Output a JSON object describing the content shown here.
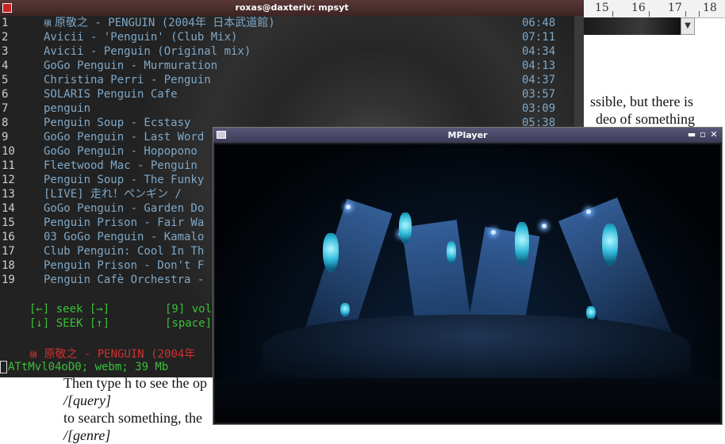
{
  "terminal": {
    "title": "roxas@daxteriv: mpsyt",
    "songs": [
      {
        "num": "1",
        "title": "原敬之 - PENGUIN (2004年 日本武道館)",
        "prefix": "槇",
        "duration": "06:48"
      },
      {
        "num": "2",
        "title": "Avicii - 'Penguin' (Club Mix)",
        "prefix": "",
        "duration": "07:11"
      },
      {
        "num": "3",
        "title": "Avicii - Penguin (Original mix)",
        "prefix": "",
        "duration": "04:34"
      },
      {
        "num": "4",
        "title": "GoGo Penguin - Murmuration",
        "prefix": "",
        "duration": "04:13"
      },
      {
        "num": "5",
        "title": "Christina Perri - Penguin",
        "prefix": "",
        "duration": "04:37"
      },
      {
        "num": "6",
        "title": "SOLARIS Penguin Cafe",
        "prefix": "",
        "duration": "03:57"
      },
      {
        "num": "7",
        "title": "penguin",
        "prefix": "",
        "duration": "03:09"
      },
      {
        "num": "8",
        "title": "Penguin Soup - Ecstasy",
        "prefix": "",
        "duration": "05:38"
      },
      {
        "num": "9",
        "title": "GoGo Penguin - Last Word",
        "prefix": "",
        "duration": ""
      },
      {
        "num": "10",
        "title": "GoGo Penguin - Hopopono",
        "prefix": "",
        "duration": ""
      },
      {
        "num": "11",
        "title": "Fleetwood Mac - Penguin",
        "prefix": "",
        "duration": ""
      },
      {
        "num": "12",
        "title": "Penguin Soup - The Funky",
        "prefix": "",
        "duration": ""
      },
      {
        "num": "13",
        "title": "[LIVE] 走れ！ペンギン /",
        "prefix": "",
        "duration": ""
      },
      {
        "num": "14",
        "title": "GoGo Penguin - Garden Do",
        "prefix": "",
        "duration": ""
      },
      {
        "num": "15",
        "title": "Penguin Prison - Fair Wa",
        "prefix": "",
        "duration": ""
      },
      {
        "num": "16",
        "title": "03 GoGo Penguin - Kamalo",
        "prefix": "",
        "duration": ""
      },
      {
        "num": "17",
        "title": "Club Penguin: Cool In Th",
        "prefix": "",
        "duration": ""
      },
      {
        "num": "18",
        "title": "Penguin Prison - Don't F",
        "prefix": "",
        "duration": ""
      },
      {
        "num": "19",
        "title": "Penguin Cafè Orchestra -",
        "prefix": "",
        "duration": ""
      }
    ],
    "controls": {
      "seek": "[←] seek [→]",
      "seek_big": "[↓] SEEK [↑]",
      "volume": "[9] vol",
      "pause": "[space]"
    },
    "now_playing_prefix": "槇",
    "now_playing": "原敬之 - PENGUIN (2004年",
    "status": "ATtMvl04oD0; webm; 39 Mb"
  },
  "mplayer": {
    "title": "MPlayer",
    "buttons": {
      "minimize": "▬",
      "maximize": "▫",
      "close": "✕"
    }
  },
  "document": {
    "ruler": [
      "15",
      "16",
      "17",
      "18"
    ],
    "right_lines": [
      "ssible, but there is",
      "deo of something"
    ],
    "bottom_lines": [
      "Then type h to see the op",
      "/[query]",
      "to search something, the",
      "/[genre]"
    ]
  },
  "colors": {
    "song_text": "#7fa8c8",
    "controls": "#3ac03a",
    "now_playing": "#d03030",
    "terminal_title_bar": "#4a2e2e",
    "mplayer_title_bar": "#4a4866"
  }
}
